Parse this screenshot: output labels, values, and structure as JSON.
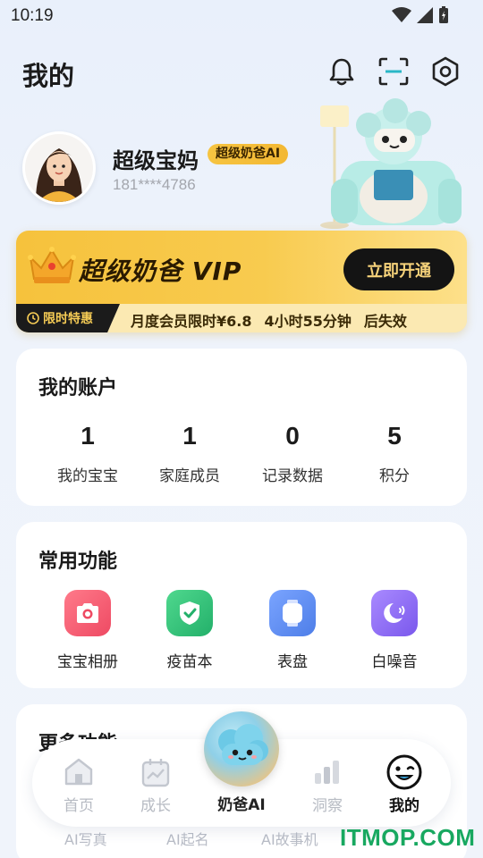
{
  "status_bar": {
    "time": "10:19"
  },
  "header": {
    "title": "我的"
  },
  "profile": {
    "username": "超级宝妈",
    "badge": "超级奶爸AI",
    "phone": "181****4786"
  },
  "vip": {
    "title": "超级奶爸 VIP",
    "button": "立即开通",
    "tag": "限时特惠",
    "promo_text": "月度会员限时¥6.8",
    "countdown": "4小时55分钟",
    "expire_text": "后失效"
  },
  "account": {
    "title": "我的账户",
    "stats": [
      {
        "value": "1",
        "label": "我的宝宝"
      },
      {
        "value": "1",
        "label": "家庭成员"
      },
      {
        "value": "0",
        "label": "记录数据"
      },
      {
        "value": "5",
        "label": "积分"
      }
    ]
  },
  "functions": {
    "title": "常用功能",
    "items": [
      {
        "label": "宝宝相册",
        "icon": "camera-icon",
        "color": "#f0566d"
      },
      {
        "label": "疫苗本",
        "icon": "shield-check-icon",
        "color": "#2fc178"
      },
      {
        "label": "表盘",
        "icon": "watch-icon",
        "color": "#5f8ff2"
      },
      {
        "label": "白噪音",
        "icon": "moon-sound-icon",
        "color": "#8b6cf0"
      }
    ]
  },
  "more": {
    "title": "更多功能",
    "items": [
      "AI写真",
      "AI起名",
      "AI故事机"
    ]
  },
  "tabbar": {
    "tabs": [
      {
        "label": "首页",
        "icon": "home-icon"
      },
      {
        "label": "成长",
        "icon": "growth-calendar-icon"
      },
      {
        "label": "奶爸AI",
        "icon": "ai-mascot-icon"
      },
      {
        "label": "洞察",
        "icon": "insight-bars-icon"
      },
      {
        "label": "我的",
        "icon": "smile-face-icon"
      }
    ],
    "active": "我的"
  },
  "watermark": "ITMOP.COM"
}
